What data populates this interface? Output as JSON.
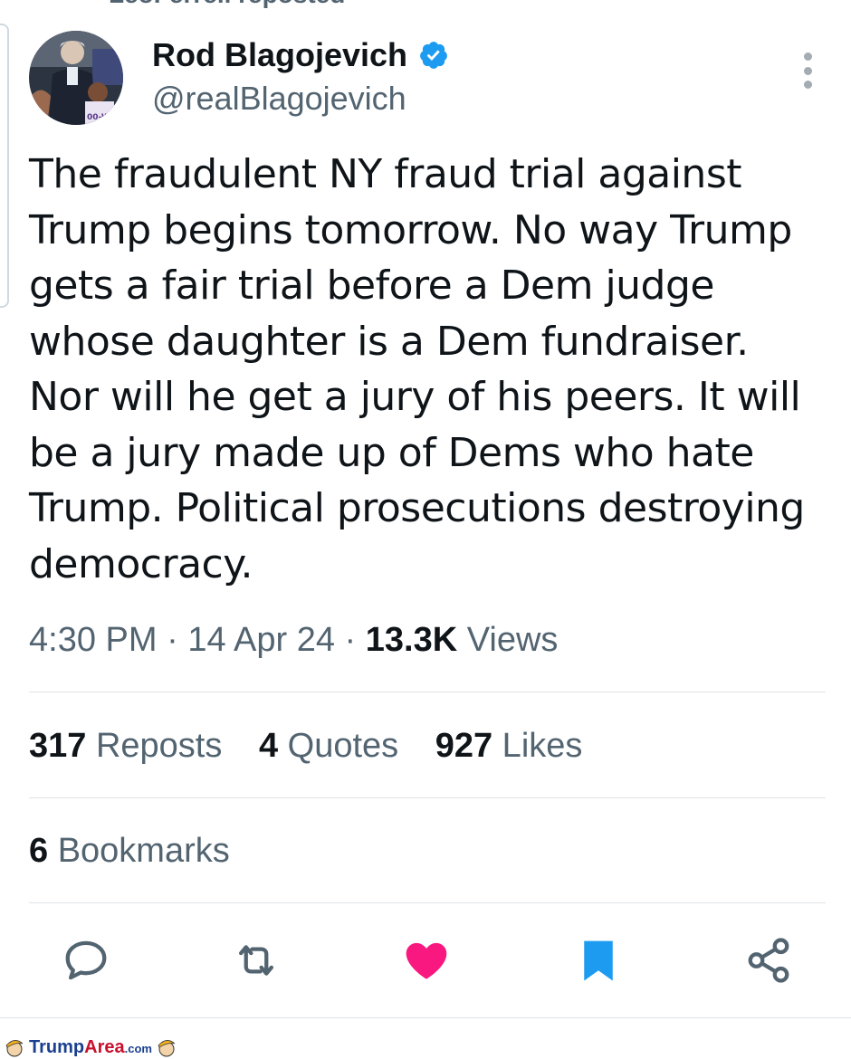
{
  "repost_banner": "LeoFerrell reposted",
  "author": {
    "name": "Rod Blagojevich",
    "handle": "@realBlagojevich",
    "verified_color": "#1d9bf0"
  },
  "tweet": {
    "text": "The fraudulent NY fraud trial against\nTrump begins tomorrow. No way Trump\ngets a fair trial before a Dem judge\nwhose daughter is a Dem fundraiser.\nNor will he get a jury of his peers. It will\nbe a jury made up of Dems who hate\nTrump. Political prosecutions destroying\ndemocracy."
  },
  "meta": {
    "time": "4:30 PM",
    "sep1": " · ",
    "date": "14 Apr 24",
    "sep2": " · ",
    "views_count": "13.3K",
    "views_label": " Views"
  },
  "stats": {
    "reposts_count": "317",
    "reposts_label": " Reposts",
    "quotes_count": "4",
    "quotes_label": " Quotes",
    "likes_count": "927",
    "likes_label": " Likes"
  },
  "bookmarks": {
    "count": "6",
    "label": " Bookmarks"
  },
  "actions": [
    {
      "icon": "reply-icon"
    },
    {
      "icon": "repost-icon"
    },
    {
      "icon": "like-icon",
      "active": true,
      "color": "#f91880"
    },
    {
      "icon": "bookmark-icon",
      "active": true,
      "color": "#1d9bf0"
    },
    {
      "icon": "share-icon"
    }
  ],
  "watermark": {
    "brand_a": "Trump",
    "brand_b": "Area",
    "brand_c": ".com"
  }
}
